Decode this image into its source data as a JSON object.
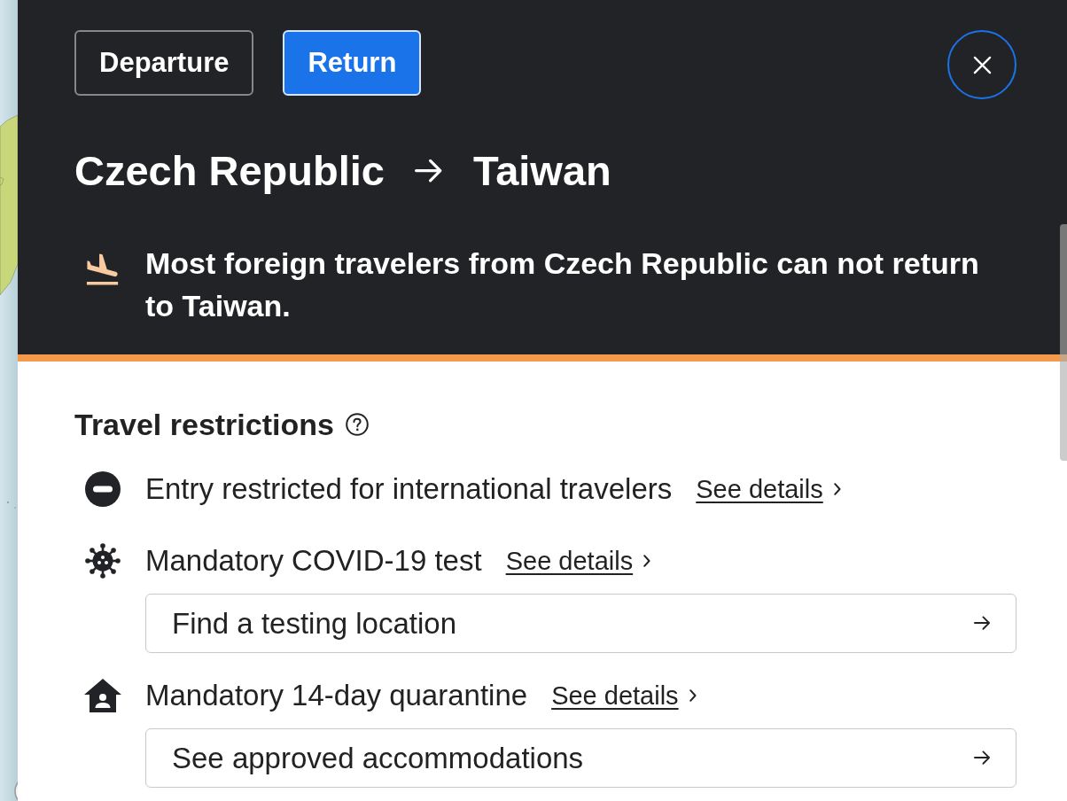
{
  "direction_tabs": [
    {
      "label": "Departure",
      "selected": false
    },
    {
      "label": "Return",
      "selected": true
    }
  ],
  "route": {
    "origin": "Czech Republic",
    "destination": "Taiwan"
  },
  "alert": {
    "message": "Most foreign travelers from Czech Republic can not return to Taiwan."
  },
  "travel_restrictions": {
    "title": "Travel restrictions",
    "items": [
      {
        "kind": "entry",
        "text": "Entry restricted for international travelers",
        "link": "See details"
      },
      {
        "kind": "test",
        "text": "Mandatory COVID-19 test",
        "link": "See details",
        "action": "Find a testing location"
      },
      {
        "kind": "quarantine",
        "text": "Mandatory 14-day quarantine",
        "link": "See details",
        "action": "See approved accommodations"
      }
    ]
  }
}
